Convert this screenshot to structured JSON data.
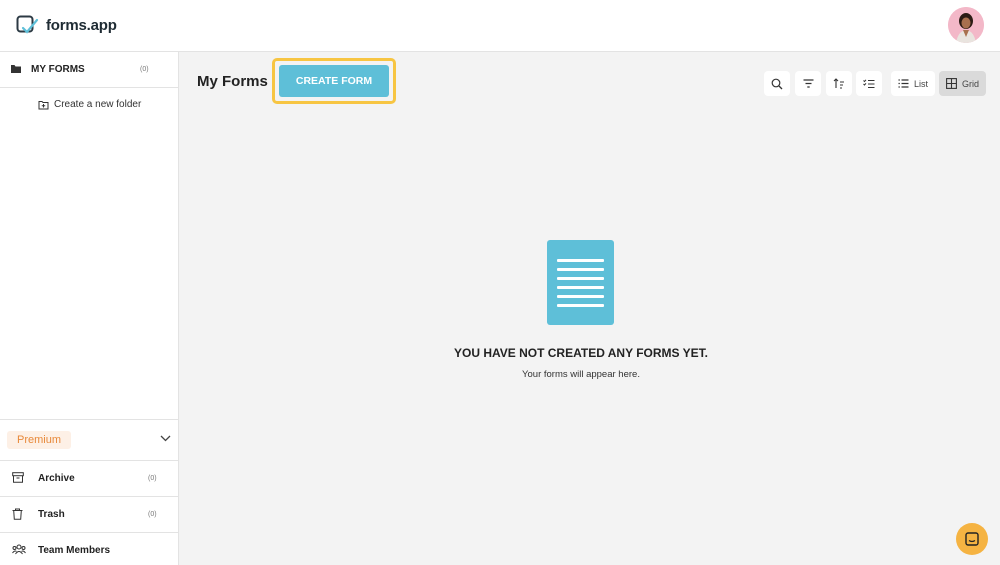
{
  "header": {
    "logo_text": "forms.app",
    "avatar_alt": "user-avatar"
  },
  "sidebar": {
    "my_forms_label": "MY FORMS",
    "my_forms_count": "(0)",
    "create_folder_label": "Create a new folder",
    "premium_label": "Premium",
    "items": [
      {
        "label": "Archive",
        "count": "(0)",
        "icon": "archive-icon"
      },
      {
        "label": "Trash",
        "count": "(0)",
        "icon": "trash-icon"
      },
      {
        "label": "Team Members",
        "icon": "team-icon"
      }
    ]
  },
  "main": {
    "title": "My Forms",
    "create_button_label": "CREATE FORM",
    "toolbar": {
      "list_label": "List",
      "grid_label": "Grid",
      "selected_view": "Grid"
    },
    "empty_state": {
      "title": "YOU HAVE NOT CREATED ANY FORMS YET.",
      "subtitle": "Your forms will appear here."
    }
  },
  "colors": {
    "accent": "#5ebfd8",
    "highlight": "#f7c542",
    "premium_text": "#e8893a",
    "chat": "#f5b342"
  }
}
